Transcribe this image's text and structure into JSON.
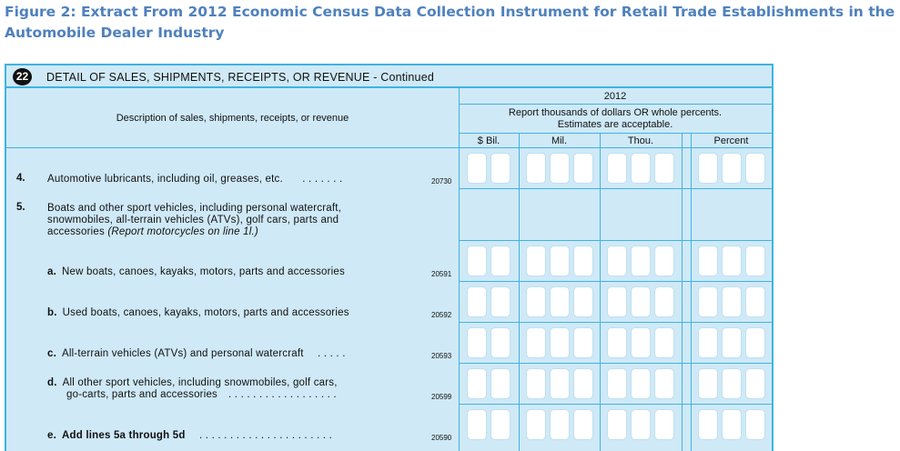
{
  "figure": {
    "title": "Figure 2: Extract From 2012 Economic Census Data Collection Instrument for Retail Trade Establishments in the Automobile Dealer Industry"
  },
  "section": {
    "number": "22",
    "title": "DETAIL OF SALES, SHIPMENTS, RECEIPTS, OR REVENUE - Continued"
  },
  "columns": {
    "description_header": "Description of sales, shipments, receipts, or revenue",
    "year": "2012",
    "instructions_line1": "Report thousands of dollars OR whole percents.",
    "instructions_line2": "Estimates are acceptable.",
    "bil": "$ Bil.",
    "mil": "Mil.",
    "thou": "Thou.",
    "percent": "Percent"
  },
  "items": {
    "line4": {
      "num": "4.",
      "text": "Automotive lubricants, including oil, greases, etc.",
      "dots": ". . . . . . .",
      "code": "20730"
    },
    "line5": {
      "num": "5.",
      "text_line1": "Boats and other sport vehicles, including personal watercraft,",
      "text_line2": "snowmobiles, all-terrain vehicles (ATVs), golf cars, parts and",
      "text_line3_plain": "accessories ",
      "text_line3_italic": "(Report motorcycles on line 1l.)"
    },
    "line5a": {
      "letter": "a.",
      "text": "New boats, canoes, kayaks, motors, parts and accessories",
      "code": "20591"
    },
    "line5b": {
      "letter": "b.",
      "text": "Used boats, canoes, kayaks, motors, parts and accessories",
      "code": "20592"
    },
    "line5c": {
      "letter": "c.",
      "text": "All-terrain vehicles (ATVs) and personal watercraft",
      "dots": ". . . . .",
      "code": "20593"
    },
    "line5d": {
      "letter": "d.",
      "text_line1": "All other sport vehicles, including snowmobiles, golf cars,",
      "text_line2": "go-carts, parts and accessories",
      "dots": ". . . . . . . . . . . . . . . . . .",
      "code": "20599"
    },
    "line5e": {
      "letter": "e.",
      "text": "Add lines 5a through 5d",
      "dots": ". . . . . . . . . . . . . . . . . . . . . .",
      "code": "20590"
    }
  },
  "colors": {
    "title_blue": "#4f81bd",
    "form_fill": "#cfe9f7",
    "form_border": "#3fb3e2",
    "cell_fill": "#ffffff"
  }
}
